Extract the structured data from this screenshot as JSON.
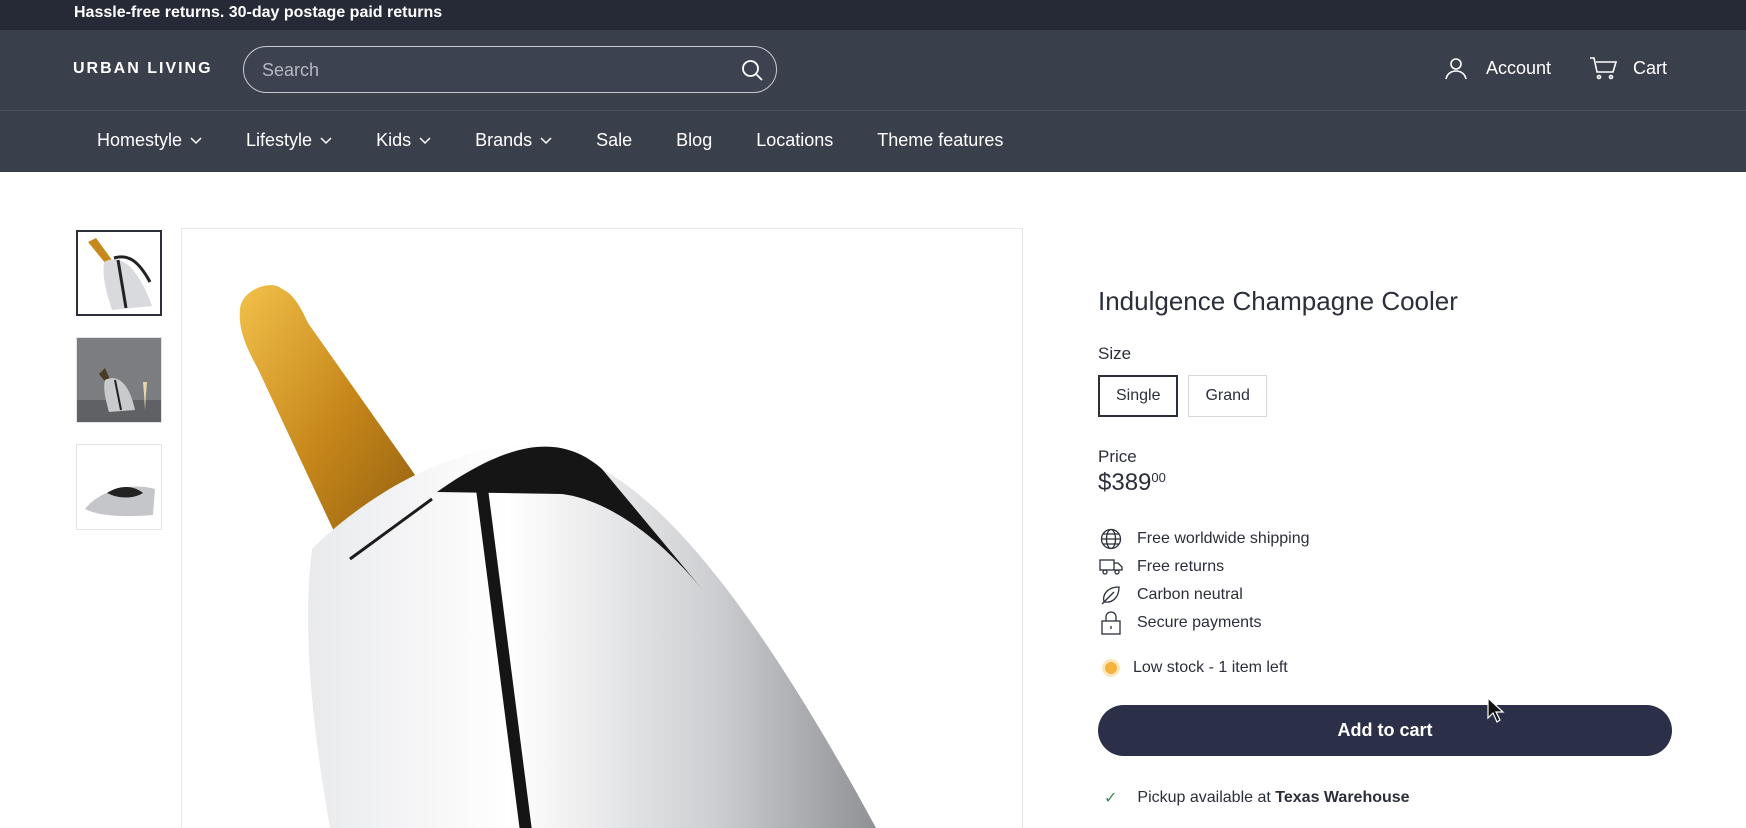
{
  "announcement": "Hassle-free returns. 30-day postage paid returns",
  "header": {
    "logo": "URBAN LIVING",
    "search_placeholder": "Search",
    "account_label": "Account",
    "cart_label": "Cart"
  },
  "nav": {
    "items": [
      {
        "label": "Homestyle",
        "has_dropdown": true
      },
      {
        "label": "Lifestyle",
        "has_dropdown": true
      },
      {
        "label": "Kids",
        "has_dropdown": true
      },
      {
        "label": "Brands",
        "has_dropdown": true
      },
      {
        "label": "Sale",
        "has_dropdown": false
      },
      {
        "label": "Blog",
        "has_dropdown": false
      },
      {
        "label": "Locations",
        "has_dropdown": false
      },
      {
        "label": "Theme features",
        "has_dropdown": false
      }
    ]
  },
  "product": {
    "title": "Indulgence Champagne Cooler",
    "size_label": "Size",
    "sizes": [
      "Single",
      "Grand"
    ],
    "selected_size": "Single",
    "price_label": "Price",
    "price_main": "$389",
    "price_cents": "00",
    "features": [
      {
        "icon": "globe-icon",
        "label": "Free worldwide shipping"
      },
      {
        "icon": "truck-icon",
        "label": "Free returns"
      },
      {
        "icon": "leaf-icon",
        "label": "Carbon neutral"
      },
      {
        "icon": "lock-icon",
        "label": "Secure payments"
      }
    ],
    "stock_text": "Low stock - 1 item left",
    "add_to_cart": "Add to cart",
    "pickup_prefix": "Pickup available at",
    "pickup_location": "Texas Warehouse"
  },
  "colors": {
    "header_bg": "#3a3f4c",
    "announcement_bg": "#262a37",
    "button_bg": "#2b2f47",
    "stock_dot": "#f3b33d"
  }
}
